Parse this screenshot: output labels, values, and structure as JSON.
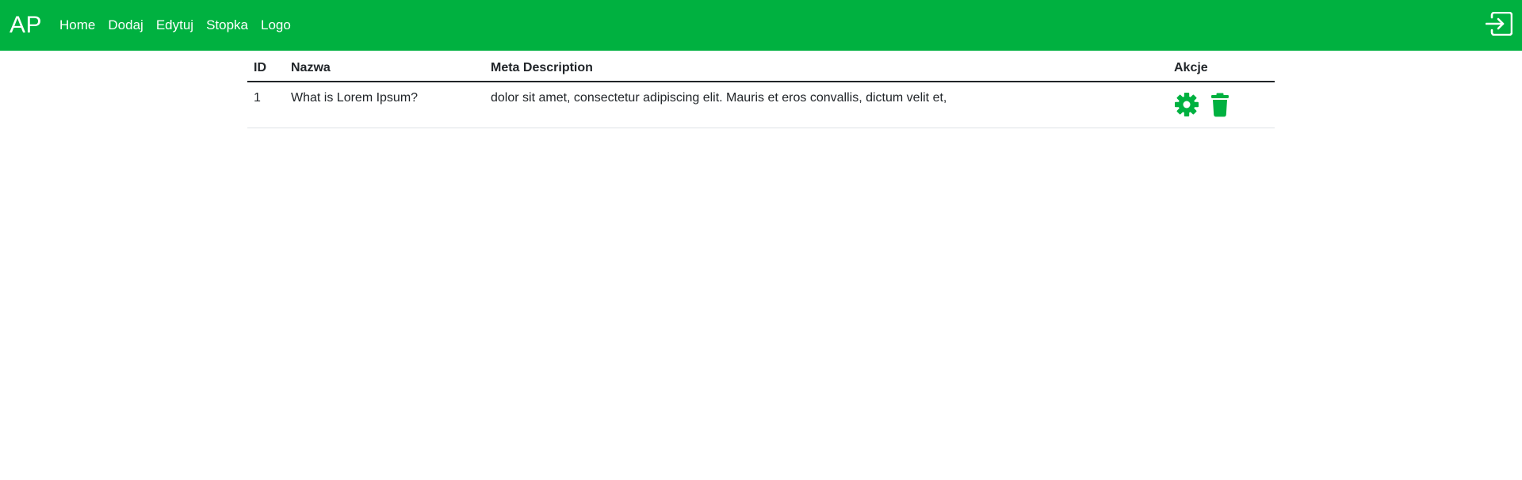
{
  "navbar": {
    "brand": "AP",
    "links": [
      "Home",
      "Dodaj",
      "Edytuj",
      "Stopka",
      "Logo"
    ],
    "logout_icon": "sign-in-icon",
    "color": "#00b140"
  },
  "table": {
    "headers": [
      "ID",
      "Nazwa",
      "Meta Description",
      "Akcje"
    ],
    "rows": [
      {
        "id": "1",
        "name": "What is Lorem Ipsum?",
        "meta": "dolor sit amet, consectetur adipiscing elit. Mauris et eros convallis, dictum velit et,",
        "actions": [
          "gear-icon",
          "trash-icon"
        ]
      }
    ]
  }
}
